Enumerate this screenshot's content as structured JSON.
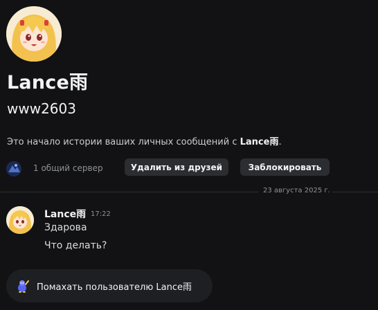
{
  "profile": {
    "display_name": "Lance雨",
    "username": "www2603",
    "intro_prefix": "Это начало истории ваших личных сообщений с ",
    "intro_name": "Lance雨",
    "intro_suffix": "."
  },
  "mutual": {
    "servers_label": "1 общий сервер",
    "remove_friend_label": "Удалить из друзей",
    "block_label": "Заблокировать"
  },
  "divider": {
    "date": "23 августа 2025 г."
  },
  "message": {
    "author": "Lance雨",
    "time": "17:22",
    "lines": [
      "Здарова",
      "Что делать?"
    ]
  },
  "wave": {
    "label": "Помахать пользователю Lance雨",
    "icon": "wave-wumpus-icon"
  },
  "colors": {
    "background": "#121214",
    "button": "#2b2d31",
    "muted_text": "#8e9297",
    "bright_text": "#f2f3f5"
  }
}
